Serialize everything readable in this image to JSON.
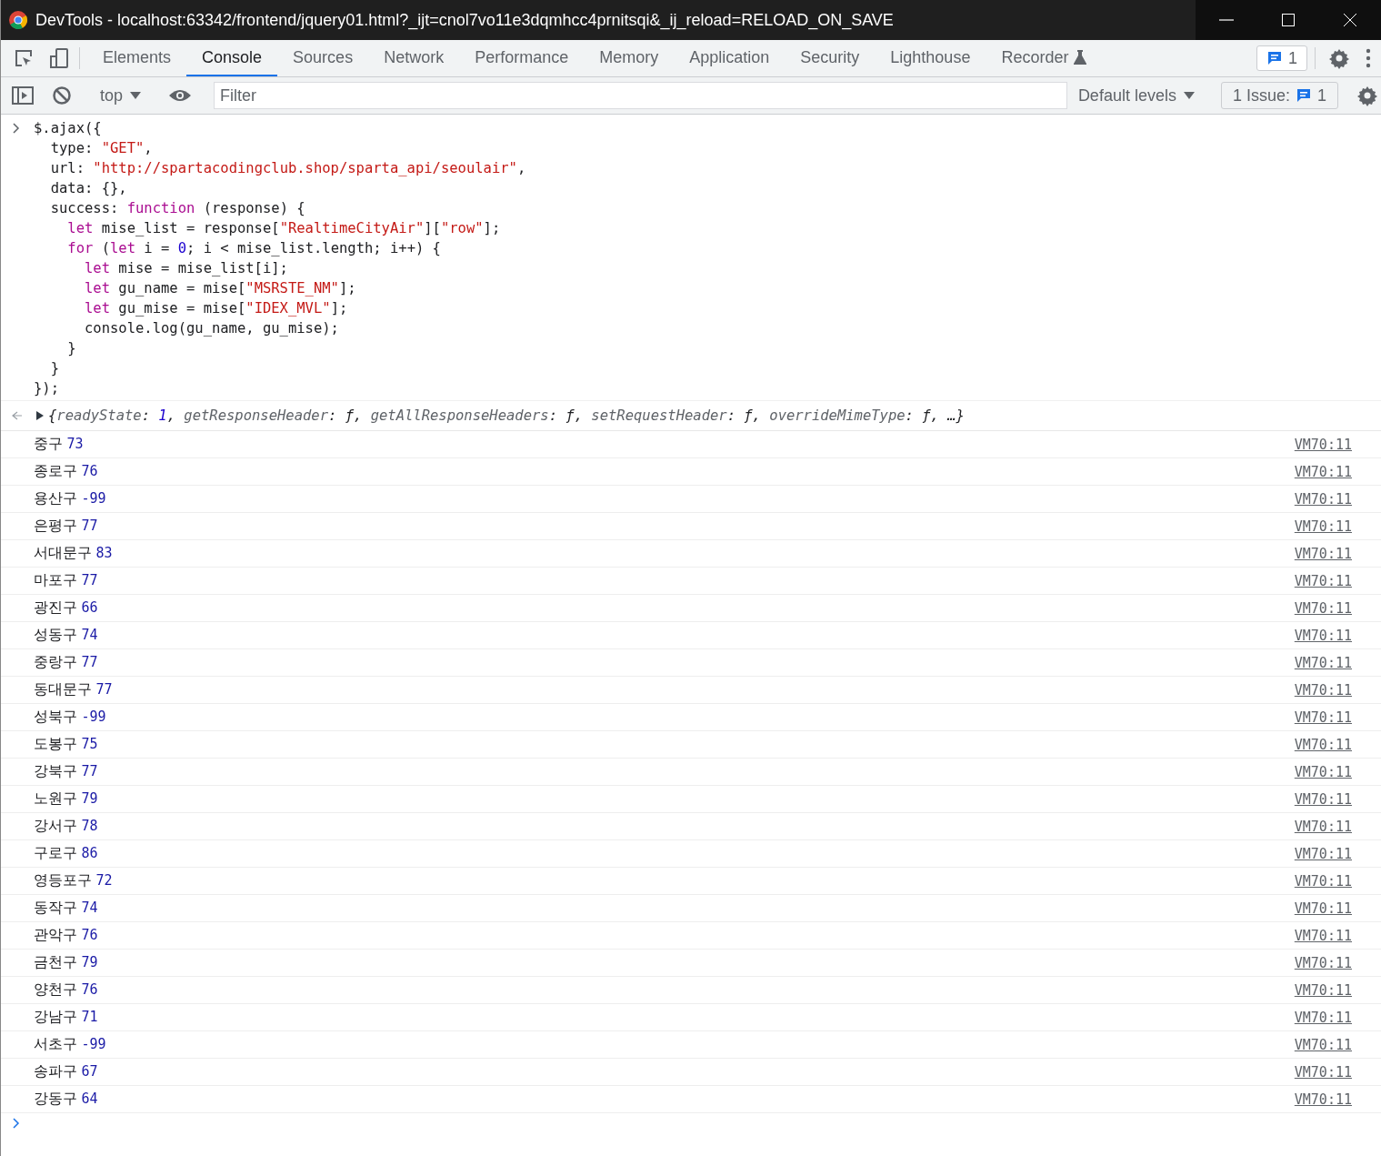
{
  "window": {
    "title": "DevTools - localhost:63342/frontend/jquery01.html?_ijt=cnol7vo11e3dqmhcc4prnitsqi&_ij_reload=RELOAD_ON_SAVE"
  },
  "tabs": [
    {
      "label": "Elements",
      "selected": false
    },
    {
      "label": "Console",
      "selected": true
    },
    {
      "label": "Sources",
      "selected": false
    },
    {
      "label": "Network",
      "selected": false
    },
    {
      "label": "Performance",
      "selected": false
    },
    {
      "label": "Memory",
      "selected": false
    },
    {
      "label": "Application",
      "selected": false
    },
    {
      "label": "Security",
      "selected": false
    },
    {
      "label": "Lighthouse",
      "selected": false
    },
    {
      "label": "Recorder",
      "selected": false
    }
  ],
  "issues_badge": "1",
  "toolbar": {
    "context": "top",
    "filter": {
      "placeholder": "Filter"
    },
    "levels": "Default levels",
    "issues_label": "1 Issue:",
    "issues_count": "1"
  },
  "input_code": [
    {
      "tokens": [
        {
          "kind": "plain",
          "text": "$.ajax({"
        }
      ],
      "children": [
        {
          "tokens": [
            {
              "kind": "plain",
              "text": "type: "
            },
            {
              "kind": "string",
              "text": "\"GET\""
            },
            {
              "kind": "plain",
              "text": ","
            }
          ]
        },
        {
          "tokens": [
            {
              "kind": "plain",
              "text": "url: "
            },
            {
              "kind": "string",
              "text": "\"http://spartacodingclub.shop/sparta_api/seoulair\""
            },
            {
              "kind": "plain",
              "text": ","
            }
          ]
        },
        {
          "tokens": [
            {
              "kind": "plain",
              "text": "data: {},"
            }
          ]
        },
        {
          "tokens": [
            {
              "kind": "plain",
              "text": "success: "
            },
            {
              "kind": "keyword",
              "text": "function"
            },
            {
              "kind": "plain",
              "text": " (response) {"
            }
          ],
          "children": [
            {
              "tokens": [
                {
                  "kind": "keyword",
                  "text": "let"
                },
                {
                  "kind": "plain",
                  "text": " mise_list = response["
                },
                {
                  "kind": "string",
                  "text": "\"RealtimeCityAir\""
                },
                {
                  "kind": "plain",
                  "text": "]["
                },
                {
                  "kind": "string",
                  "text": "\"row\""
                },
                {
                  "kind": "plain",
                  "text": "];"
                }
              ]
            },
            {
              "tokens": [
                {
                  "kind": "keyword",
                  "text": "for"
                },
                {
                  "kind": "plain",
                  "text": " ("
                },
                {
                  "kind": "keyword",
                  "text": "let"
                },
                {
                  "kind": "plain",
                  "text": " i = "
                },
                {
                  "kind": "number",
                  "text": "0"
                },
                {
                  "kind": "plain",
                  "text": "; i < mise_list.length; i++) {"
                }
              ],
              "children": [
                {
                  "tokens": [
                    {
                      "kind": "keyword",
                      "text": "let"
                    },
                    {
                      "kind": "plain",
                      "text": " mise = mise_list[i];"
                    }
                  ]
                },
                {
                  "tokens": [
                    {
                      "kind": "keyword",
                      "text": "let"
                    },
                    {
                      "kind": "plain",
                      "text": " gu_name = mise["
                    },
                    {
                      "kind": "string",
                      "text": "\"MSRSTE_NM\""
                    },
                    {
                      "kind": "plain",
                      "text": "];"
                    }
                  ]
                },
                {
                  "tokens": [
                    {
                      "kind": "keyword",
                      "text": "let"
                    },
                    {
                      "kind": "plain",
                      "text": " gu_mise = mise["
                    },
                    {
                      "kind": "string",
                      "text": "\"IDEX_MVL\""
                    },
                    {
                      "kind": "plain",
                      "text": "];"
                    }
                  ]
                },
                {
                  "tokens": [
                    {
                      "kind": "plain",
                      "text": "console.log(gu_name, gu_mise);"
                    }
                  ]
                }
              ]
            },
            {
              "tokens": [
                {
                  "kind": "plain",
                  "text": "}"
                }
              ]
            }
          ]
        },
        {
          "tokens": [
            {
              "kind": "plain",
              "text": "}"
            }
          ]
        }
      ]
    },
    {
      "tokens": [
        {
          "kind": "plain",
          "text": "});"
        }
      ]
    }
  ],
  "result": {
    "expanded": false,
    "tokens": [
      {
        "kind": "plain",
        "text": "{"
      },
      {
        "kind": "key",
        "text": "readyState"
      },
      {
        "kind": "plain",
        "text": ": "
      },
      {
        "kind": "number",
        "text": "1"
      },
      {
        "kind": "plain",
        "text": ", "
      },
      {
        "kind": "key",
        "text": "getResponseHeader"
      },
      {
        "kind": "plain",
        "text": ": ƒ, "
      },
      {
        "kind": "key",
        "text": "getAllResponseHeaders"
      },
      {
        "kind": "plain",
        "text": ": ƒ, "
      },
      {
        "kind": "key",
        "text": "setRequestHeader"
      },
      {
        "kind": "plain",
        "text": ": ƒ, "
      },
      {
        "kind": "key",
        "text": "overrideMimeType"
      },
      {
        "kind": "plain",
        "text": ": ƒ, …}"
      }
    ]
  },
  "logs": [
    {
      "name": "중구",
      "value": "73",
      "source": "VM70:11"
    },
    {
      "name": "종로구",
      "value": "76",
      "source": "VM70:11"
    },
    {
      "name": "용산구",
      "value": "-99",
      "source": "VM70:11"
    },
    {
      "name": "은평구",
      "value": "77",
      "source": "VM70:11"
    },
    {
      "name": "서대문구",
      "value": "83",
      "source": "VM70:11"
    },
    {
      "name": "마포구",
      "value": "77",
      "source": "VM70:11"
    },
    {
      "name": "광진구",
      "value": "66",
      "source": "VM70:11"
    },
    {
      "name": "성동구",
      "value": "74",
      "source": "VM70:11"
    },
    {
      "name": "중랑구",
      "value": "77",
      "source": "VM70:11"
    },
    {
      "name": "동대문구",
      "value": "77",
      "source": "VM70:11"
    },
    {
      "name": "성북구",
      "value": "-99",
      "source": "VM70:11"
    },
    {
      "name": "도봉구",
      "value": "75",
      "source": "VM70:11"
    },
    {
      "name": "강북구",
      "value": "77",
      "source": "VM70:11"
    },
    {
      "name": "노원구",
      "value": "79",
      "source": "VM70:11"
    },
    {
      "name": "강서구",
      "value": "78",
      "source": "VM70:11"
    },
    {
      "name": "구로구",
      "value": "86",
      "source": "VM70:11"
    },
    {
      "name": "영등포구",
      "value": "72",
      "source": "VM70:11"
    },
    {
      "name": "동작구",
      "value": "74",
      "source": "VM70:11"
    },
    {
      "name": "관악구",
      "value": "76",
      "source": "VM70:11"
    },
    {
      "name": "금천구",
      "value": "79",
      "source": "VM70:11"
    },
    {
      "name": "양천구",
      "value": "76",
      "source": "VM70:11"
    },
    {
      "name": "강남구",
      "value": "71",
      "source": "VM70:11"
    },
    {
      "name": "서초구",
      "value": "-99",
      "source": "VM70:11"
    },
    {
      "name": "송파구",
      "value": "67",
      "source": "VM70:11"
    },
    {
      "name": "강동구",
      "value": "64",
      "source": "VM70:11"
    }
  ]
}
